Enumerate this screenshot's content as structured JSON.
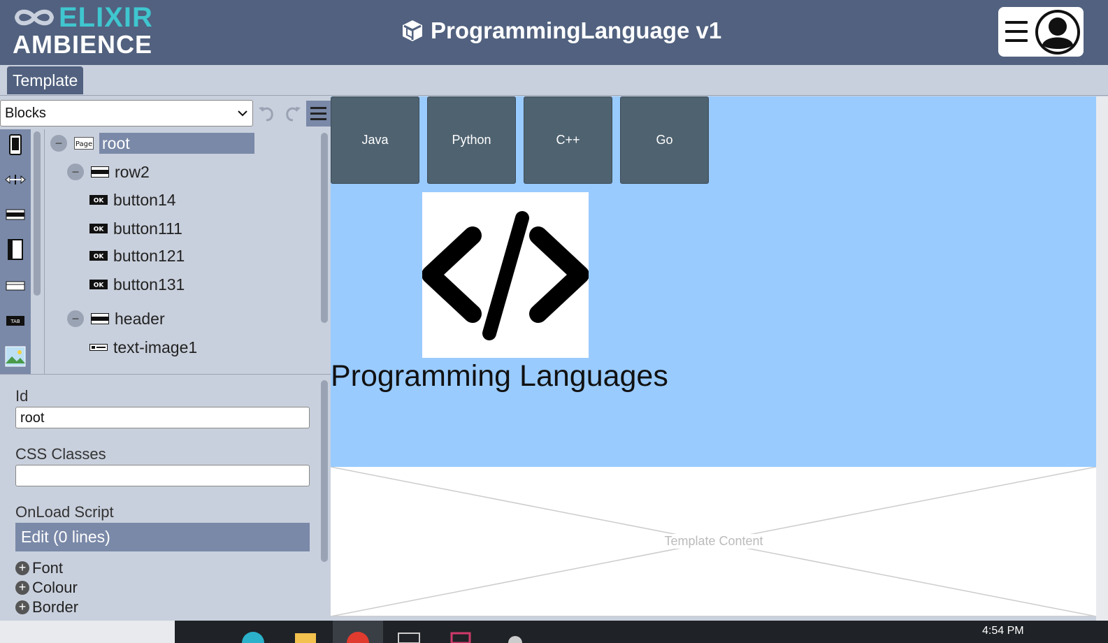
{
  "header": {
    "logo_line1": "ELIXIR",
    "logo_line2": "AMBIENCE",
    "title": "ProgrammingLanguage v1"
  },
  "tabs": [
    {
      "label": "Template",
      "active": true
    }
  ],
  "toolbar": {
    "blocks_selected": "Blocks"
  },
  "palette": {
    "items": [
      "phone-icon",
      "breakpoint-icon",
      "row-icon",
      "column-icon",
      "card-icon",
      "tab-icon",
      "image-icon"
    ]
  },
  "tree": {
    "nodes": [
      {
        "label": "root",
        "icon": "Page",
        "collapsible": true,
        "selected": true
      },
      {
        "label": "row2",
        "collapsible": true
      },
      {
        "label": "button14",
        "icon": "OK"
      },
      {
        "label": "button111",
        "icon": "OK"
      },
      {
        "label": "button121",
        "icon": "OK"
      },
      {
        "label": "button131",
        "icon": "OK"
      },
      {
        "label": "header",
        "collapsible": true
      },
      {
        "label": "text-image1"
      }
    ]
  },
  "props": {
    "id_label": "Id",
    "id_value": "root",
    "css_label": "CSS Classes",
    "css_value": "",
    "onload_label": "OnLoad Script",
    "edit_label": "Edit (0 lines)",
    "sections": [
      "Font",
      "Colour",
      "Border"
    ]
  },
  "canvas": {
    "buttons": [
      "Java",
      "Python",
      "C++",
      "Go"
    ],
    "heading": "Programming Languages",
    "background": "#99cbff",
    "button_color": "#4f6270"
  },
  "template_content": {
    "label": "Template Content"
  },
  "taskbar": {
    "clock": "4:54 PM"
  },
  "colors": {
    "header_bg": "#51617f",
    "accent": "#3fc6cf",
    "panel_bg": "#c9d0dd",
    "selected_bg": "#7a89a8"
  }
}
